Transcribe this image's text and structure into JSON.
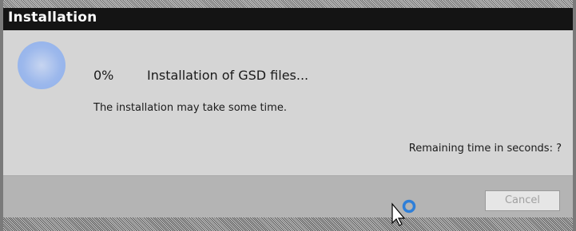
{
  "window": {
    "title": "Installation"
  },
  "progress": {
    "percent_text": "0%",
    "percent_value": 0,
    "heading": "Installation of GSD files...",
    "subtext": "The installation may take some time.",
    "remaining": "Remaining time in seconds: ?"
  },
  "footer": {
    "cancel_label": "Cancel",
    "cancel_disabled": true
  },
  "icons": {
    "spinner": "progress-spinner-icon",
    "cursor": "busy-cursor-icon"
  },
  "colors": {
    "titlebar": "#141414",
    "content_bg": "#d5d5d5",
    "footer_bg": "#b4b4b4",
    "spinner_blue": "#9cb8ec"
  }
}
